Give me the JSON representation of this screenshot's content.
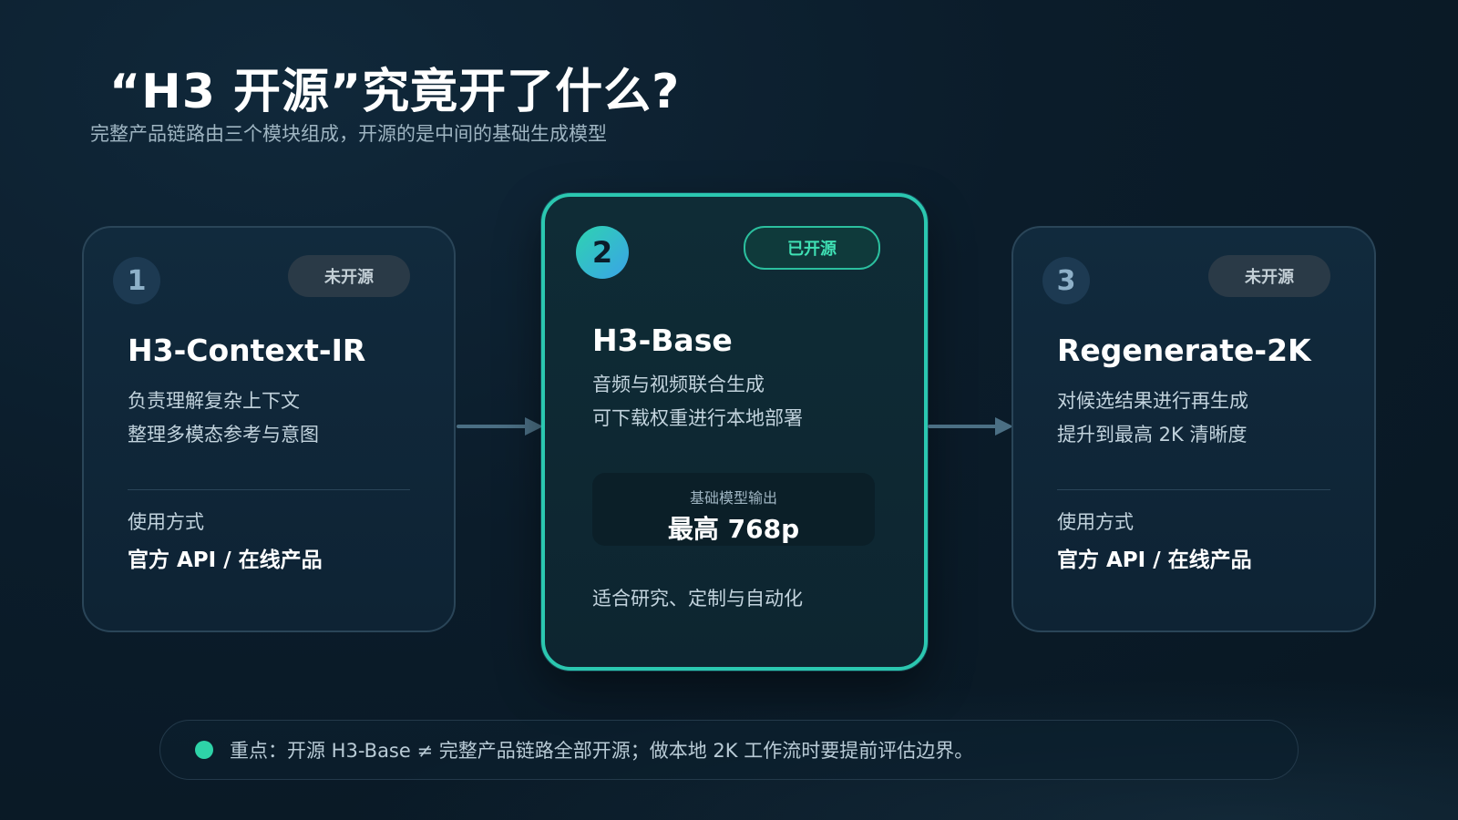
{
  "header": {
    "title": "“H3 开源”究竟开了什么?",
    "subtitle": "完整产品链路由三个模块组成，开源的是中间的基础生成模型"
  },
  "cards": [
    {
      "number": "1",
      "badge": "未开源",
      "name": "H3-Context-IR",
      "desc": [
        "负责理解复杂上下文",
        "整理多模态参考与意图"
      ],
      "use_label": "使用方式",
      "use_value": "官方 API / 在线产品"
    },
    {
      "number": "2",
      "badge": "已开源",
      "name": "H3-Base",
      "desc": [
        "音频与视频联合生成",
        "可下载权重进行本地部署"
      ],
      "output_label": "基础模型输出",
      "output_value": "最高 768p",
      "fit": "适合研究、定制与自动化"
    },
    {
      "number": "3",
      "badge": "未开源",
      "name": "Regenerate-2K",
      "desc": [
        "对候选结果进行再生成",
        "提升到最高 2K 清晰度"
      ],
      "use_label": "使用方式",
      "use_value": "官方 API / 在线产品"
    }
  ],
  "note": {
    "text": "重点：开源 H3-Base ≠ 完整产品链路全部开源；做本地 2K 工作流时要提前评估边界。"
  },
  "colors": {
    "accent_teal": "#2ed3b0",
    "accent_blue": "#3aa3e8",
    "background": "#0b1c2a"
  }
}
